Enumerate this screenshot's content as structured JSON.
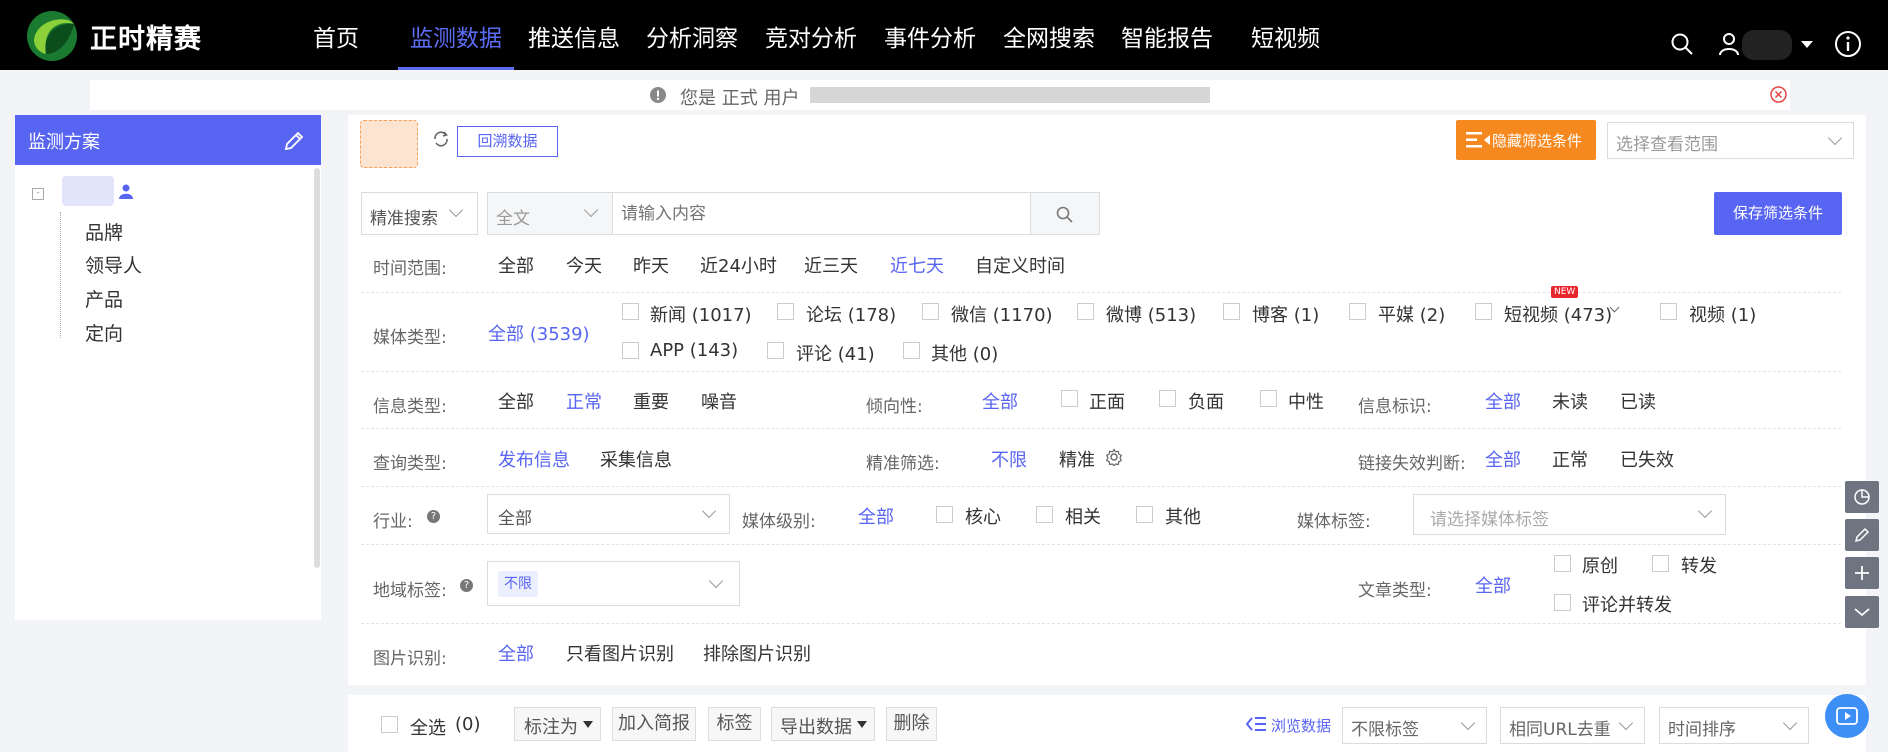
{
  "brand": {
    "name": "正时精赛",
    "accent": "#5865f2",
    "orange": "#f5891f"
  },
  "nav": {
    "items": [
      "首页",
      "监测数据",
      "推送信息",
      "分析洞察",
      "竞对分析",
      "事件分析",
      "全网搜索",
      "智能报告",
      "短视频"
    ],
    "active": "监测数据"
  },
  "topicons": [
    "search-icon",
    "user-icon",
    "caret-down-icon",
    "info-icon"
  ],
  "notice": {
    "text": "您是 正式 用户"
  },
  "left": {
    "title": "监测方案",
    "items": [
      "品牌",
      "领导人",
      "产品",
      "定向"
    ]
  },
  "toolbar": {
    "backtrack": "回溯数据",
    "hide_filters": "隐藏筛选条件",
    "scope_placeholder": "选择查看范围",
    "save_filters": "保存筛选条件"
  },
  "search": {
    "mode": "精准搜索",
    "field": "全文",
    "placeholder": "请输入内容"
  },
  "time": {
    "label": "时间范围:",
    "options": [
      "全部",
      "今天",
      "昨天",
      "近24小时",
      "近三天",
      "近七天",
      "自定义时间"
    ],
    "selected": "近七天"
  },
  "media": {
    "label": "媒体类型:",
    "all": "全部 (3539)",
    "row1": [
      "新闻 (1017)",
      "论坛 (178)",
      "微信 (1170)",
      "微博 (513)",
      "博客 (1)",
      "平媒 (2)",
      "短视频 (473)",
      "视频 (1)"
    ],
    "row2": [
      "APP (143)",
      "评论 (41)",
      "其他 (0)"
    ],
    "new_badge": "NEW"
  },
  "info": {
    "label": "信息类型:",
    "options": [
      "全部",
      "正常",
      "重要",
      "噪音"
    ],
    "selected": "正常"
  },
  "tendency": {
    "label": "倾向性:",
    "all": "全部",
    "options": [
      "正面",
      "负面",
      "中性"
    ]
  },
  "mark": {
    "label": "信息标识:",
    "options": [
      "全部",
      "未读",
      "已读"
    ],
    "selected": "全部"
  },
  "query": {
    "label": "查询类型:",
    "options": [
      "发布信息",
      "采集信息"
    ],
    "selected": "发布信息"
  },
  "precise": {
    "label": "精准筛选:",
    "options": [
      "不限",
      "精准"
    ],
    "selected": "不限"
  },
  "link": {
    "label": "链接失效判断:",
    "options": [
      "全部",
      "正常",
      "已失效"
    ],
    "selected": "全部"
  },
  "industry": {
    "label": "行业:",
    "value": "全部"
  },
  "medialevel": {
    "label": "媒体级别:",
    "all": "全部",
    "options": [
      "核心",
      "相关",
      "其他"
    ]
  },
  "mediatag": {
    "label": "媒体标签:",
    "placeholder": "请选择媒体标签"
  },
  "region": {
    "label": "地域标签:",
    "value": "不限"
  },
  "article": {
    "label": "文章类型:",
    "all": "全部",
    "options": [
      "原创",
      "转发",
      "评论并转发"
    ]
  },
  "image": {
    "label": "图片识别:",
    "options": [
      "全部",
      "只看图片识别",
      "排除图片识别"
    ],
    "selected": "全部"
  },
  "bottom": {
    "select_all": "全选",
    "count": "(0)",
    "mark_as": "标注为",
    "add_brief": "加入简报",
    "tag": "标签",
    "export": "导出数据",
    "delete": "删除",
    "browse": "浏览数据",
    "tag_filter": "不限标签",
    "dedupe": "相同URL去重",
    "sort": "时间排序"
  }
}
